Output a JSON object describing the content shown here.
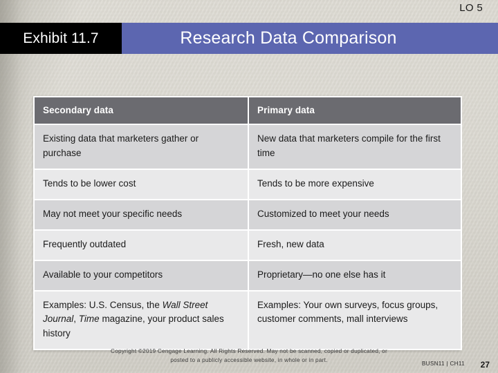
{
  "slide": {
    "lo_tag": "LO 5",
    "exhibit_label": "Exhibit 11.7",
    "title": "Research Data Comparison",
    "colors": {
      "title_band": "#5c66b0",
      "exhibit_box": "#000000",
      "table_header": "#6b6b70",
      "row_shade_dark": "#d5d5d7",
      "row_shade_light": "#e9e9ea",
      "background": "#d9d6cd"
    }
  },
  "table": {
    "headers": [
      "Secondary data",
      "Primary data"
    ],
    "rows": [
      {
        "secondary": "Existing data that marketers gather or purchase",
        "primary": "New data that marketers compile for the first time"
      },
      {
        "secondary": "Tends to be lower cost",
        "primary": "Tends to be more expensive"
      },
      {
        "secondary": "May not meet your specific needs",
        "primary": "Customized to meet your needs"
      },
      {
        "secondary": "Frequently outdated",
        "primary": "Fresh, new data"
      },
      {
        "secondary": "Available to your competitors",
        "primary": "Proprietary—no one else has it"
      },
      {
        "secondary_html": "Examples: U.S. Census, the <em>Wall Street Journal</em>, <em>Time</em> magazine, your product sales history",
        "secondary": "Examples: U.S. Census, the Wall Street Journal, Time magazine, your product sales history",
        "primary": "Examples: Your own surveys, focus groups, customer comments, mall interviews"
      }
    ]
  },
  "footer": {
    "copyright_line1": "Copyright ©2019 Cengage Learning. All Rights Reserved. May not be scanned, copied or duplicated, or",
    "copyright_line2": "posted to a publicly accessible website, in whole or in part.",
    "book_tag": "BUSN11 | CH11",
    "page_number": "27"
  }
}
